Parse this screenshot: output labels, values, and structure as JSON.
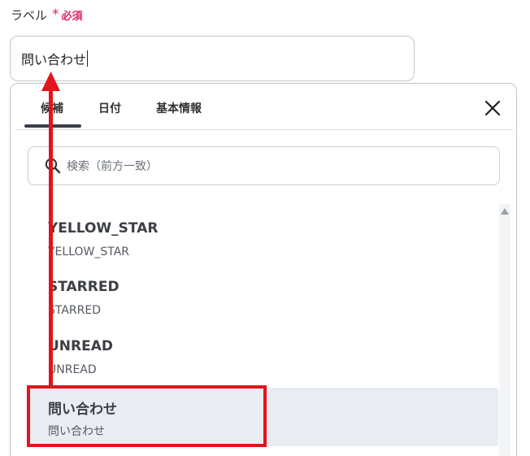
{
  "field": {
    "label": "ラベル",
    "required_star": "*",
    "required_text": "必須",
    "value": "問い合わせ"
  },
  "popup": {
    "tabs": [
      {
        "label": "候補",
        "active": true
      },
      {
        "label": "日付",
        "active": false
      },
      {
        "label": "基本情報",
        "active": false
      }
    ],
    "close_icon": "close-icon",
    "search": {
      "icon": "search-icon",
      "placeholder": "検索（前方一致）"
    },
    "options": [
      {
        "title": "YELLOW_STAR",
        "subtitle": "YELLOW_STAR",
        "selected": false
      },
      {
        "title": "STARRED",
        "subtitle": "STARRED",
        "selected": false
      },
      {
        "title": "UNREAD",
        "subtitle": "UNREAD",
        "selected": false
      },
      {
        "title": "問い合わせ",
        "subtitle": "問い合わせ",
        "selected": true
      }
    ]
  },
  "annotation": {
    "color": "#e3141b"
  }
}
